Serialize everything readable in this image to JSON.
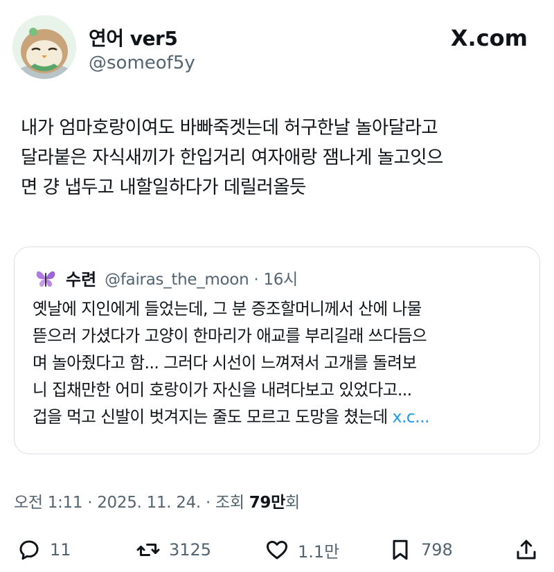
{
  "author": {
    "name": "연어 ver5",
    "handle": "@someof5y"
  },
  "brand": "X.com",
  "tweet": {
    "text": "내가 엄마호랑이여도 바빠죽겟는데 허구한날 놀아달라고\n달라붙은 자식새끼가 한입거리 여자애랑 잼나게 놀고잇으\n면 걍 냅두고 내할일하다가 데릴러올듯"
  },
  "quote": {
    "name": "수련",
    "handle_time": "@fairas_the_moon · 16시",
    "text": "옛날에 지인에게 들었는데, 그 분 증조할머니께서 산에 나물\n뜯으러 가셨다가 고양이 한마리가 애교를 부리길래 쓰다듬으\n며 놀아줬다고 함... 그러다 시선이 느껴져서 고개를 돌려보\n니 집채만한 어미 호랑이가 자신을 내려다보고 있었다고...\n겁을 먹고 신발이 벗겨지는 줄도 모르고 도망을 쳤는데 ",
    "link": "x.c..."
  },
  "meta": {
    "datetime": "오전 1:11 · 2025. 11. 24. · 조회 ",
    "views": "79만",
    "views_suffix": "회"
  },
  "actions": {
    "replies": "11",
    "reposts": "3125",
    "likes": "1.1만",
    "bookmarks": "798"
  },
  "icons": {
    "reply": "reply-icon",
    "repost": "repost-icon",
    "like": "heart-icon",
    "bookmark": "bookmark-icon",
    "share": "share-icon"
  },
  "colors": {
    "text": "#0f1419",
    "secondary": "#536471",
    "link": "#1d9bf0",
    "border": "#dadfe3"
  }
}
